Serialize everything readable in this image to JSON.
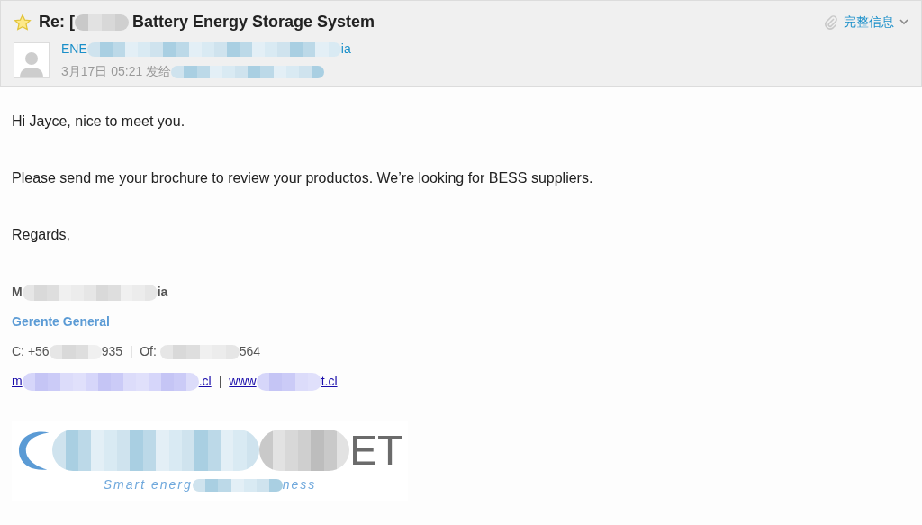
{
  "header": {
    "subject_parts": [
      "Re: [",
      "Battery Energy Storage System"
    ],
    "sender_parts": [
      "ENE",
      "ia"
    ],
    "date": "3月17日 05:21 发给",
    "details_link": "完整信息"
  },
  "body": {
    "paragraphs": [
      "Hi Jayce, nice to meet you.",
      "Please send me your brochure to review your productos. We’re looking for BESS suppliers.",
      "Regards,"
    ]
  },
  "signature": {
    "name_parts": [
      "M",
      "ia"
    ],
    "title": "Gerente General",
    "phone_parts": [
      "C: +56",
      "935  |  Of: ",
      "564"
    ],
    "email_parts": [
      "m",
      ".cl"
    ],
    "separator": "|",
    "web_parts": [
      "www",
      "t.cl"
    ]
  },
  "logo": {
    "text": "ET",
    "tagline_parts": [
      "Smart energ",
      "ness"
    ]
  }
}
